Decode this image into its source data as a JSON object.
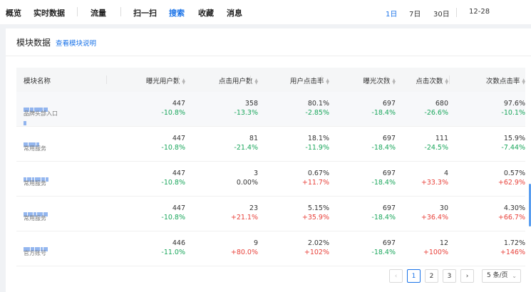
{
  "nav": {
    "items": [
      "概览",
      "实时数据",
      "流量",
      "扫一扫",
      "搜索",
      "收藏",
      "消息"
    ],
    "active": "搜索"
  },
  "date_range": {
    "options": [
      "1日",
      "7日",
      "30日"
    ],
    "active": "1日",
    "date": "12-28"
  },
  "card": {
    "title": "模块数据",
    "link": "查看模块说明"
  },
  "table": {
    "columns": [
      "模块名称",
      "曝光用户数",
      "点击用户数",
      "用户点击率",
      "曝光次数",
      "点击次数",
      "次数点击率"
    ],
    "rows": [
      {
        "category": "品牌头部入口",
        "cells": [
          {
            "value": "447",
            "delta": "-10.8%",
            "dir": "down"
          },
          {
            "value": "358",
            "delta": "-13.3%",
            "dir": "down"
          },
          {
            "value": "80.1%",
            "delta": "-2.85%",
            "dir": "down"
          },
          {
            "value": "697",
            "delta": "-18.4%",
            "dir": "down"
          },
          {
            "value": "680",
            "delta": "-26.6%",
            "dir": "down"
          },
          {
            "value": "97.6%",
            "delta": "-10.1%",
            "dir": "down"
          }
        ]
      },
      {
        "category": "常用服务",
        "cells": [
          {
            "value": "447",
            "delta": "-10.8%",
            "dir": "down"
          },
          {
            "value": "81",
            "delta": "-21.4%",
            "dir": "down"
          },
          {
            "value": "18.1%",
            "delta": "-11.9%",
            "dir": "down"
          },
          {
            "value": "697",
            "delta": "-18.4%",
            "dir": "down"
          },
          {
            "value": "111",
            "delta": "-24.5%",
            "dir": "down"
          },
          {
            "value": "15.9%",
            "delta": "-7.44%",
            "dir": "down"
          }
        ]
      },
      {
        "category": "常用服务",
        "cells": [
          {
            "value": "447",
            "delta": "-10.8%",
            "dir": "down"
          },
          {
            "value": "3",
            "delta": "0.00%",
            "dir": "flat"
          },
          {
            "value": "0.67%",
            "delta": "+11.7%",
            "dir": "up"
          },
          {
            "value": "697",
            "delta": "-18.4%",
            "dir": "down"
          },
          {
            "value": "4",
            "delta": "+33.3%",
            "dir": "up"
          },
          {
            "value": "0.57%",
            "delta": "+62.9%",
            "dir": "up"
          }
        ]
      },
      {
        "category": "常用服务",
        "cells": [
          {
            "value": "447",
            "delta": "-10.8%",
            "dir": "down"
          },
          {
            "value": "23",
            "delta": "+21.1%",
            "dir": "up"
          },
          {
            "value": "5.15%",
            "delta": "+35.9%",
            "dir": "up"
          },
          {
            "value": "697",
            "delta": "-18.4%",
            "dir": "down"
          },
          {
            "value": "30",
            "delta": "+36.4%",
            "dir": "up"
          },
          {
            "value": "4.30%",
            "delta": "+66.7%",
            "dir": "up"
          }
        ]
      },
      {
        "category": "官方账号",
        "cells": [
          {
            "value": "446",
            "delta": "-11.0%",
            "dir": "down"
          },
          {
            "value": "9",
            "delta": "+80.0%",
            "dir": "up"
          },
          {
            "value": "2.02%",
            "delta": "+102%",
            "dir": "up"
          },
          {
            "value": "697",
            "delta": "-18.4%",
            "dir": "down"
          },
          {
            "value": "12",
            "delta": "+100%",
            "dir": "up"
          },
          {
            "value": "1.72%",
            "delta": "+146%",
            "dir": "up"
          }
        ]
      }
    ]
  },
  "pagination": {
    "pages": [
      "1",
      "2",
      "3"
    ],
    "active": "1",
    "prev_icon": "chevron-left-icon",
    "next_icon": "chevron-right-icon",
    "page_size": "5 条/页"
  },
  "colors": {
    "accent": "#1a73e8",
    "down": "#19a65b",
    "up": "#e8413a"
  }
}
